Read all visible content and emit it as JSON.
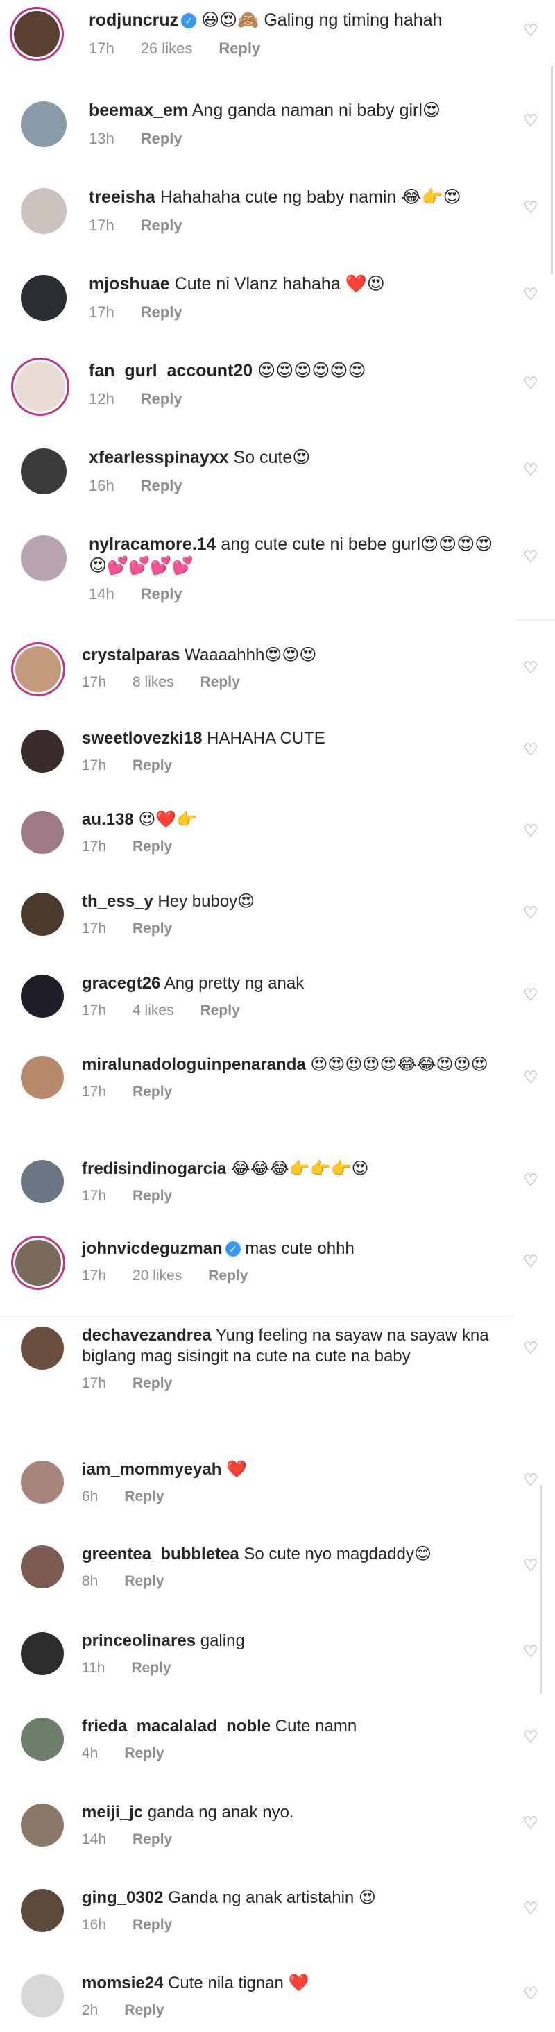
{
  "comments": [
    {
      "username": "rodjuncruz",
      "verified": true,
      "text": "😃😍🙈 Galing ng timing hahah",
      "time": "17h",
      "likes": "26 likes",
      "reply": "Reply",
      "avatar_color": "#5a4030",
      "ring": true
    },
    {
      "username": "beemax_em",
      "verified": false,
      "text": "Ang ganda naman ni baby girl😍",
      "time": "13h",
      "likes": "",
      "reply": "Reply",
      "avatar_color": "#8a9aa8",
      "ring": false
    },
    {
      "username": "treeisha",
      "verified": false,
      "text": "Hahahaha cute ng baby namin 😂👉😍",
      "time": "17h",
      "likes": "",
      "reply": "Reply",
      "avatar_color": "#c9c2bd",
      "ring": false
    },
    {
      "username": "mjoshuae",
      "verified": false,
      "text": "Cute ni Vlanz hahaha ❤️😍",
      "time": "17h",
      "likes": "",
      "reply": "Reply",
      "avatar_color": "#2a2e33",
      "ring": false
    },
    {
      "username": "fan_gurl_account20",
      "verified": false,
      "text": "😍😍😍😍😍😍",
      "time": "12h",
      "likes": "",
      "reply": "Reply",
      "avatar_color": "#e8dcd4",
      "ring": true
    },
    {
      "username": "xfearlesspinayxx",
      "verified": false,
      "text": "So cute😍",
      "time": "16h",
      "likes": "",
      "reply": "Reply",
      "avatar_color": "#3b3b3b",
      "ring": false
    },
    {
      "username": "nylracamore.14",
      "verified": false,
      "text": "ang cute cute ni bebe gurl😍😍😍😍😍💕💕💕💕",
      "time": "14h",
      "likes": "",
      "reply": "Reply",
      "avatar_color": "#b8a4b0",
      "ring": false
    },
    {
      "username": "crystalparas",
      "verified": false,
      "text": "Waaaahhh😍😍😍",
      "time": "17h",
      "likes": "8 likes",
      "reply": "Reply",
      "avatar_color": "#c49a7c",
      "ring": true
    },
    {
      "username": "sweetlovezki18",
      "verified": false,
      "text": "HAHAHA CUTE",
      "time": "17h",
      "likes": "",
      "reply": "Reply",
      "avatar_color": "#3a2c2a",
      "ring": false
    },
    {
      "username": "au.138",
      "verified": false,
      "text": "😍❤️👉",
      "time": "17h",
      "likes": "",
      "reply": "Reply",
      "avatar_color": "#9d7a86",
      "ring": false
    },
    {
      "username": "th_ess_y",
      "verified": false,
      "text": "Hey buboy😍",
      "time": "17h",
      "likes": "",
      "reply": "Reply",
      "avatar_color": "#4a3a2e",
      "ring": false
    },
    {
      "username": "gracegt26",
      "verified": false,
      "text": "Ang pretty ng anak",
      "time": "17h",
      "likes": "4 likes",
      "reply": "Reply",
      "avatar_color": "#1f1f2a",
      "ring": false
    },
    {
      "username": "miralunadologuinpenaranda",
      "verified": false,
      "text": "😍😍😍😍😍😂😂😍😍😍",
      "time": "17h",
      "likes": "",
      "reply": "Reply",
      "avatar_color": "#b88a6c",
      "ring": false
    },
    {
      "username": "fredisindinogarcia",
      "verified": false,
      "text": "😂😂😂👉👉👉😍",
      "time": "17h",
      "likes": "",
      "reply": "Reply",
      "avatar_color": "#6a7684",
      "ring": false
    },
    {
      "username": "johnvicdeguzman",
      "verified": true,
      "text": "mas cute ohhh",
      "time": "17h",
      "likes": "20 likes",
      "reply": "Reply",
      "avatar_color": "#7a6a5c",
      "ring": true
    },
    {
      "username": "dechavezandrea",
      "verified": false,
      "text": "Yung feeling na sayaw na sayaw kna biglang mag sisingit na cute na cute na baby",
      "time": "17h",
      "likes": "",
      "reply": "Reply",
      "avatar_color": "#6b4e3e",
      "ring": false
    },
    {
      "username": "iam_mommyeyah",
      "verified": false,
      "text": "❤️",
      "time": "6h",
      "likes": "",
      "reply": "Reply",
      "avatar_color": "#a8857a",
      "ring": false
    },
    {
      "username": "greentea_bubbletea",
      "verified": false,
      "text": "So cute nyo magdaddy😊",
      "time": "8h",
      "likes": "",
      "reply": "Reply",
      "avatar_color": "#7c5c52",
      "ring": false
    },
    {
      "username": "princeolinares",
      "verified": false,
      "text": "galing",
      "time": "11h",
      "likes": "",
      "reply": "Reply",
      "avatar_color": "#2c2c2c",
      "ring": false
    },
    {
      "username": "frieda_macalalad_noble",
      "verified": false,
      "text": "Cute namn",
      "time": "4h",
      "likes": "",
      "reply": "Reply",
      "avatar_color": "#6d7f6a",
      "ring": false
    },
    {
      "username": "meiji_jc",
      "verified": false,
      "text": "ganda ng anak nyo.",
      "time": "14h",
      "likes": "",
      "reply": "Reply",
      "avatar_color": "#8c7868",
      "ring": false
    },
    {
      "username": "ging_0302",
      "verified": false,
      "text": "Ganda ng anak artistahin 😍",
      "time": "16h",
      "likes": "",
      "reply": "Reply",
      "avatar_color": "#5e4a3c",
      "ring": false
    },
    {
      "username": "momsie24",
      "verified": false,
      "text": "Cute nila tignan ❤️",
      "time": "2h",
      "likes": "",
      "reply": "Reply",
      "avatar_color": "#d7d7d7",
      "ring": false
    }
  ],
  "icons": {
    "heart": "heart-outline-icon",
    "verified": "verified-badge-icon"
  }
}
